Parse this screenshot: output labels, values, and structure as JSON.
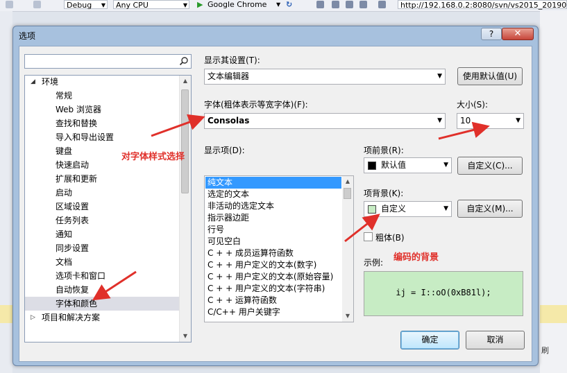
{
  "ide": {
    "config_value": "Debug",
    "platform_value": "Any CPU",
    "browser_label": "Google Chrome",
    "url_fragment": "http://192.168.0.2:8080/svn/vs2015_20190",
    "bottom_text": "刷"
  },
  "dialog": {
    "title": "选项",
    "help_label": "?",
    "close_label": "✕"
  },
  "search": {
    "value": "",
    "placeholder": ""
  },
  "tree": {
    "items": [
      {
        "label": "环境",
        "toggle": "◢"
      },
      {
        "label": "常规"
      },
      {
        "label": "Web 浏览器"
      },
      {
        "label": "查找和替换"
      },
      {
        "label": "导入和导出设置"
      },
      {
        "label": "键盘"
      },
      {
        "label": "快速启动"
      },
      {
        "label": "扩展和更新"
      },
      {
        "label": "启动"
      },
      {
        "label": "区域设置"
      },
      {
        "label": "任务列表"
      },
      {
        "label": "通知"
      },
      {
        "label": "同步设置"
      },
      {
        "label": "文档"
      },
      {
        "label": "选项卡和窗口"
      },
      {
        "label": "自动恢复"
      },
      {
        "label": "字体和颜色",
        "selected": true
      },
      {
        "label": "项目和解决方案",
        "toggle": "▷"
      }
    ]
  },
  "settings": {
    "show_settings_label": "显示其设置(T):",
    "show_settings_value": "文本编辑器",
    "use_defaults_label": "使用默认值(U)",
    "font_label": "字体(粗体表示等宽字体)(F):",
    "font_value": "Consolas",
    "size_label": "大小(S):",
    "size_value": "10",
    "display_items_label": "显示项(D):",
    "display_items": [
      "纯文本",
      "选定的文本",
      "非活动的选定文本",
      "指示器边距",
      "行号",
      "可见空白",
      "C + + 成员运算符函数",
      "C + + 用户定义的文本(数字)",
      "C + + 用户定义的文本(原始容量)",
      "C + + 用户定义的文本(字符串)",
      "C + + 运算符函数",
      "C/C++ 用户关键字"
    ],
    "selected_display_item": 0,
    "foreground_label": "项前景(R):",
    "foreground_value": "默认值",
    "foreground_color": "#000000",
    "custom_fg_label": "自定义(C)...",
    "background_label": "项背景(K):",
    "background_value": "自定义",
    "background_color": "#c7ecc4",
    "custom_bg_label": "自定义(M)...",
    "bold_label": "粗体(B)",
    "sample_label": "示例:",
    "sample_text": "ij = I::oO(0xB81l);"
  },
  "footer": {
    "ok_label": "确定",
    "cancel_label": "取消"
  },
  "annotations": {
    "font_note": "对字体样式选择",
    "bg_note": "编码的背景",
    "color": "#e0302a"
  }
}
